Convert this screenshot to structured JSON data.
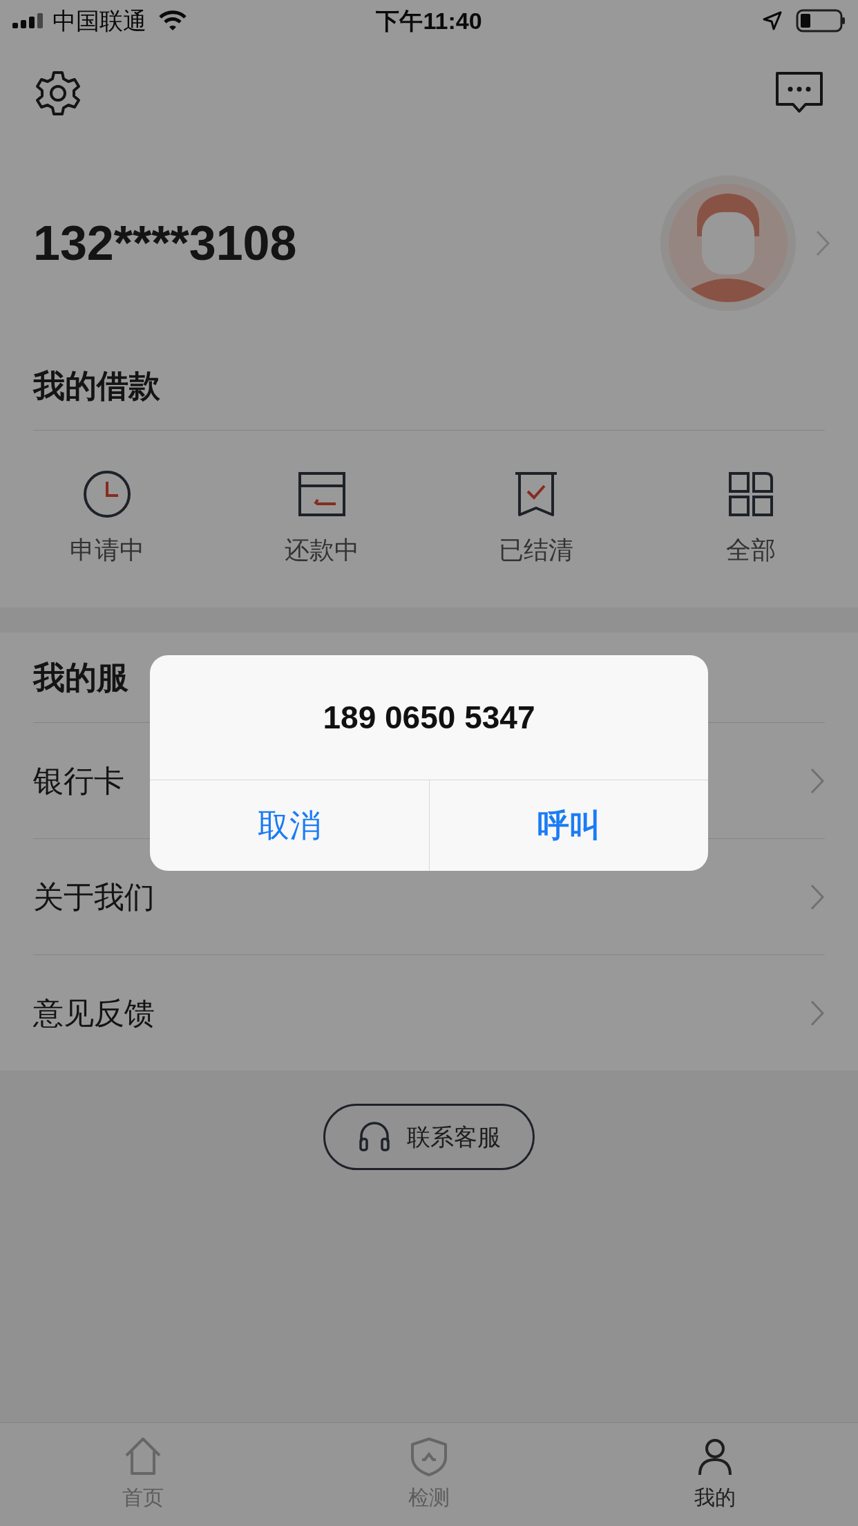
{
  "status_bar": {
    "carrier": "中国联通",
    "time": "下午11:40"
  },
  "profile": {
    "phone": "132****3108"
  },
  "loans": {
    "title": "我的借款",
    "items": [
      {
        "kind": "applying",
        "label": "申请中"
      },
      {
        "kind": "repaying",
        "label": "还款中"
      },
      {
        "kind": "settled",
        "label": "已结清"
      },
      {
        "kind": "all",
        "label": "全部"
      }
    ]
  },
  "services": {
    "title": "我的服",
    "items": [
      "银行卡",
      "关于我们",
      "意见反馈"
    ]
  },
  "contact_button": "联系客服",
  "tab_bar": [
    {
      "kind": "home",
      "label": "首页",
      "selected": false
    },
    {
      "kind": "shield",
      "label": "检测",
      "selected": false
    },
    {
      "kind": "person",
      "label": "我的",
      "selected": true
    }
  ],
  "dialog": {
    "title": "189 0650 5347",
    "buttons": [
      "取消",
      "呼叫"
    ]
  }
}
